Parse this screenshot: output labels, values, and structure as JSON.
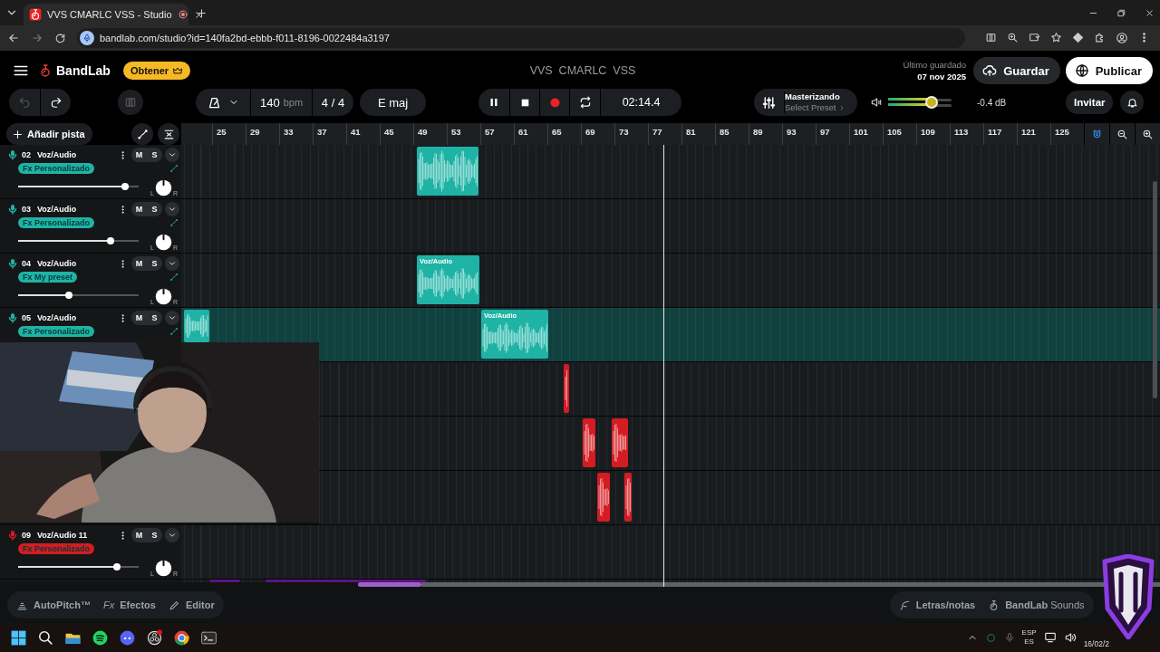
{
  "browser": {
    "tab": {
      "title": "VVS CMARLC VSS - Studio",
      "recording": true
    },
    "url": "bandlab.com/studio?id=140fa2bd-ebbb-f011-8196-0022484a3197"
  },
  "header": {
    "brand": "BandLab",
    "upgrade": "Obtener",
    "title": "VVS  CMARLC  VSS",
    "saved_label": "Último guardado",
    "saved_date": "07 nov 2025",
    "save": "Guardar",
    "publish": "Publicar"
  },
  "toolbar": {
    "tempo": "140",
    "tempo_unit": "bpm",
    "time_signature": "4 / 4",
    "key": "E maj",
    "playing": true,
    "time": "02:14.4",
    "mastering": {
      "title": "Masterizando",
      "preset": "Select Preset"
    },
    "volume": {
      "level": 0.69,
      "reading": "-0.4 dB"
    },
    "invite": "Invitar"
  },
  "ruler": {
    "add_track": "Añadir pista",
    "marks": [
      "25",
      "29",
      "33",
      "37",
      "41",
      "45",
      "49",
      "53",
      "57",
      "61",
      "65",
      "69",
      "73",
      "77",
      "81",
      "85",
      "89",
      "93",
      "97",
      "101",
      "105",
      "109",
      "113",
      "117",
      "121",
      "125"
    ],
    "snap": true
  },
  "tracks": [
    {
      "number": "02",
      "name": "Voz/Audio",
      "mute": "M",
      "solo": "S",
      "fx": "Fx Personalizado",
      "level": 0.89,
      "pan_left": "L",
      "pan_right": "R",
      "color": "#1fb3a6",
      "selected": false,
      "clips": [
        {
          "kind": "audio"
        }
      ]
    },
    {
      "number": "03",
      "name": "Voz/Audio",
      "mute": "M",
      "solo": "S",
      "fx": "Fx Personalizado",
      "level": 0.77,
      "pan_left": "L",
      "pan_right": "R",
      "color": "#1fb3a6",
      "selected": false
    },
    {
      "number": "04",
      "name": "Voz/Audio",
      "mute": "M",
      "solo": "S",
      "fx": "Fx My preset",
      "level": 0.42,
      "pan_left": "L",
      "pan_right": "R",
      "color": "#1fb3a6",
      "selected": false,
      "clips": [
        {
          "kind": "audio",
          "label": "Voz/Audio"
        }
      ]
    },
    {
      "number": "05",
      "name": "Voz/Audio",
      "mute": "M",
      "solo": "S",
      "fx": "Fx Personalizado",
      "color": "#1fb3a6",
      "selected": true,
      "clips": [
        {
          "kind": "audio"
        },
        {
          "kind": "audio",
          "label": "Voz/Audio"
        }
      ]
    },
    {
      "color": "#d41c22",
      "selected": false,
      "clips": [
        {
          "kind": "audio"
        }
      ]
    },
    {
      "color": "#d41c22",
      "selected": false,
      "clips": [
        {
          "kind": "audio"
        },
        {
          "kind": "audio"
        }
      ]
    },
    {
      "color": "#d41c22",
      "selected": false,
      "clips": [
        {
          "kind": "audio"
        },
        {
          "kind": "audio"
        }
      ]
    },
    {
      "number": "09",
      "name": "Voz/Audio 11",
      "mute": "M",
      "solo": "S",
      "fx": "Fx Personalizado",
      "level": 0.82,
      "pan_left": "L",
      "pan_right": "R",
      "color": "#d41c22",
      "selected": false
    },
    {
      "color": "#5c1480",
      "selected": false,
      "clips": [
        {
          "kind": "audio"
        },
        {
          "kind": "audio"
        }
      ]
    }
  ],
  "bottom_bar": {
    "tools": [
      {
        "label": "AutoPitch™",
        "kind": "autopitch"
      },
      {
        "label": "Efectos",
        "kind": "effects",
        "prefix": "Fx"
      },
      {
        "label": "Editor",
        "kind": "editor"
      }
    ],
    "lyrics": "Letras/notas",
    "sounds": "**BandLab** Sounds"
  },
  "taskbar": {
    "language": "ESP",
    "region": "ES",
    "date": "16/02/2"
  }
}
